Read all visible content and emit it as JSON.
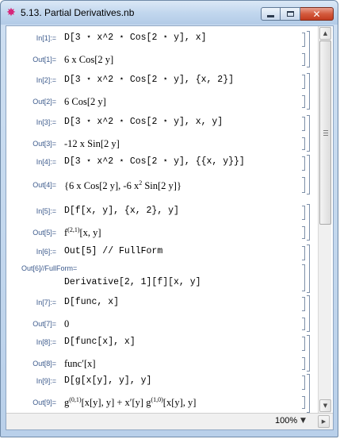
{
  "window": {
    "title": "5.13. Partial Derivatives.nb",
    "app_icon": "mathematica-star-icon",
    "minimize_glyph": "minimize-icon",
    "maximize_glyph": "maximize-icon",
    "close_glyph": "✕"
  },
  "cells": [
    {
      "label": "In[1]:=",
      "kind": "input",
      "text": "D[3 ⋆ x^2 ⋆ Cos[2 ⋆ y], x]"
    },
    {
      "label": "Out[1]=",
      "kind": "output",
      "text": "6 x Cos[2 y]"
    },
    {
      "label": "In[2]:=",
      "kind": "input",
      "text": "D[3 ⋆ x^2 ⋆ Cos[2 ⋆ y], {x, 2}]"
    },
    {
      "label": "Out[2]=",
      "kind": "output",
      "text": "6 Cos[2 y]"
    },
    {
      "label": "In[3]:=",
      "kind": "input",
      "text": "D[3 ⋆ x^2 ⋆ Cos[2 ⋆ y], x, y]"
    },
    {
      "label": "Out[3]=",
      "kind": "output",
      "text": "-12 x Sin[2 y]"
    },
    {
      "label": "In[4]:=",
      "kind": "input",
      "text": "D[3 ⋆ x^2 ⋆ Cos[2 ⋆ y], {{x, y}}]"
    },
    {
      "label": "Out[4]=",
      "kind": "output",
      "text_a": "{6 x Cos[2 y], -6 x",
      "sup": "2",
      "text_b": " Sin[2 y]}"
    },
    {
      "label": "In[5]:=",
      "kind": "input",
      "text": "D[f[x, y], {x, 2}, y]"
    },
    {
      "label": "Out[5]=",
      "kind": "output",
      "text_a": "f",
      "sup": "(2,1)",
      "text_b": "[x, y]"
    },
    {
      "label": "In[6]:=",
      "kind": "input",
      "text": "Out[5] // FullForm"
    },
    {
      "label": "Out[6]//FullForm=",
      "kind": "output",
      "text": "Derivative[2, 1][f][x, y]"
    },
    {
      "label": "In[7]:=",
      "kind": "input",
      "text": "D[func, x]"
    },
    {
      "label": "Out[7]=",
      "kind": "output",
      "text": "0"
    },
    {
      "label": "In[8]:=",
      "kind": "input",
      "text": "D[func[x], x]"
    },
    {
      "label": "Out[8]=",
      "kind": "output",
      "text": "func′[x]"
    },
    {
      "label": "In[9]:=",
      "kind": "input",
      "text": "D[g[x[y], y], y]"
    },
    {
      "label": "Out[9]=",
      "kind": "output",
      "text_a": "g",
      "sup": "(0,1)",
      "text_b": "[x[y], y] + x′[y] g",
      "sup2": "(1,0)",
      "text_c": "[x[y], y]"
    }
  ],
  "statusbar": {
    "zoom": "100%"
  }
}
